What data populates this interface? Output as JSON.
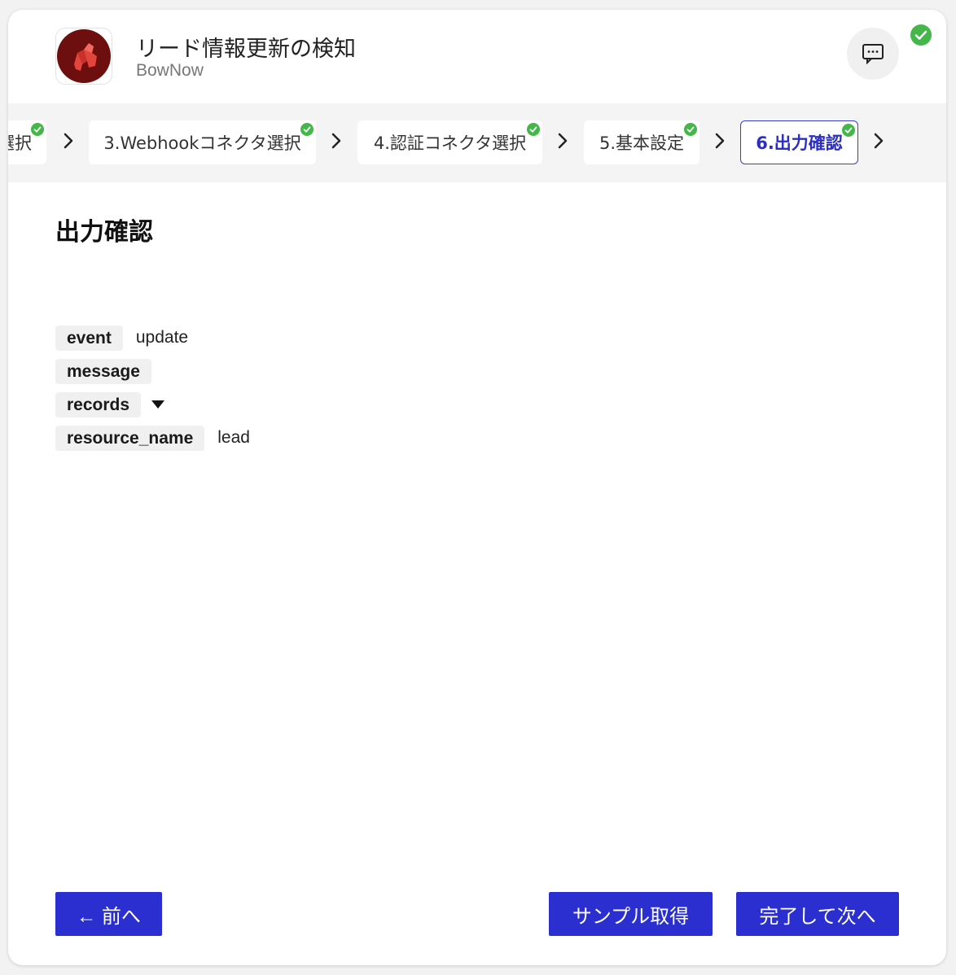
{
  "header": {
    "title": "リード情報更新の検知",
    "subtitle": "BowNow"
  },
  "colors": {
    "accent": "#2b2fcf",
    "success": "#45b649",
    "brand_icon": "#7a1010"
  },
  "steps": [
    {
      "label": "選択",
      "done": true,
      "active": false
    },
    {
      "label": "3.Webhookコネクタ選択",
      "done": true,
      "active": false
    },
    {
      "label": "4.認証コネクタ選択",
      "done": true,
      "active": false
    },
    {
      "label": "5.基本設定",
      "done": true,
      "active": false
    },
    {
      "label": "6.出力確認",
      "done": true,
      "active": true
    }
  ],
  "main": {
    "title": "出力確認",
    "outputs": [
      {
        "key": "event",
        "value": "update"
      },
      {
        "key": "message",
        "value": ""
      },
      {
        "key": "records",
        "value": "",
        "expandable": true
      },
      {
        "key": "resource_name",
        "value": "lead"
      }
    ]
  },
  "footer": {
    "prev_label": "← 前へ",
    "sample_label": "サンプル取得",
    "next_label": "完了して次へ"
  }
}
